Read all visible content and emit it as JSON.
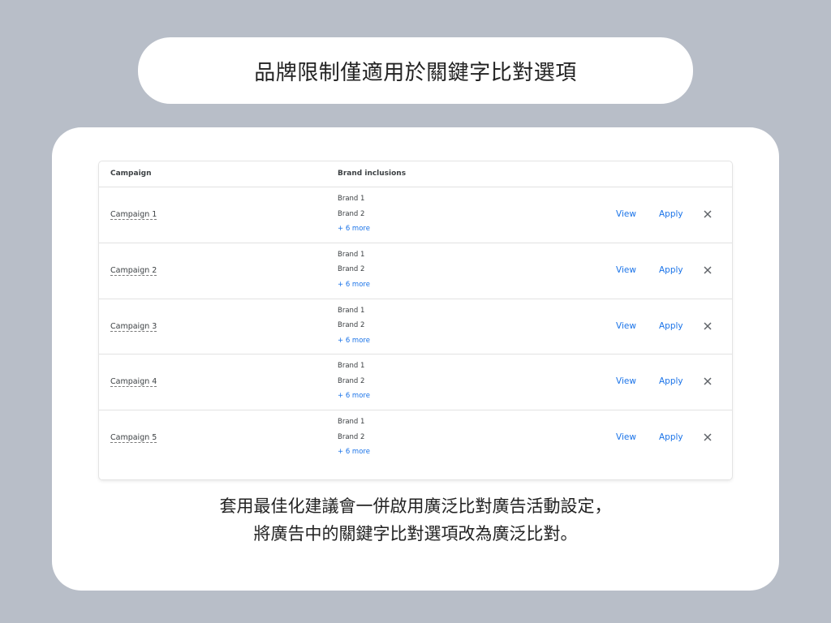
{
  "title": "品牌限制僅適用於關鍵字比對選項",
  "table": {
    "headers": {
      "campaign": "Campaign",
      "brand_inclusions": "Brand inclusions"
    },
    "rows": [
      {
        "campaign": "Campaign 1",
        "brand_a": "Brand 1",
        "brand_b": "Brand 2",
        "more": "+ 6 more",
        "view": "View",
        "apply": "Apply"
      },
      {
        "campaign": "Campaign 2",
        "brand_a": "Brand 1",
        "brand_b": "Brand 2",
        "more": "+ 6 more",
        "view": "View",
        "apply": "Apply"
      },
      {
        "campaign": "Campaign 3",
        "brand_a": "Brand 1",
        "brand_b": "Brand 2",
        "more": "+ 6 more",
        "view": "View",
        "apply": "Apply"
      },
      {
        "campaign": "Campaign 4",
        "brand_a": "Brand 1",
        "brand_b": "Brand 2",
        "more": "+ 6 more",
        "view": "View",
        "apply": "Apply"
      },
      {
        "campaign": "Campaign 5",
        "brand_a": "Brand 1",
        "brand_b": "Brand 2",
        "more": "+ 6 more",
        "view": "View",
        "apply": "Apply"
      }
    ],
    "dismiss_icon": "close-icon"
  },
  "caption": {
    "line1": "套用最佳化建議會一併啟用廣泛比對廣告活動設定，",
    "line2": "將廣告中的關鍵字比對選項改為廣泛比對。"
  },
  "colors": {
    "background": "#b8bec8",
    "link": "#1a73e8",
    "card": "#ffffff"
  }
}
